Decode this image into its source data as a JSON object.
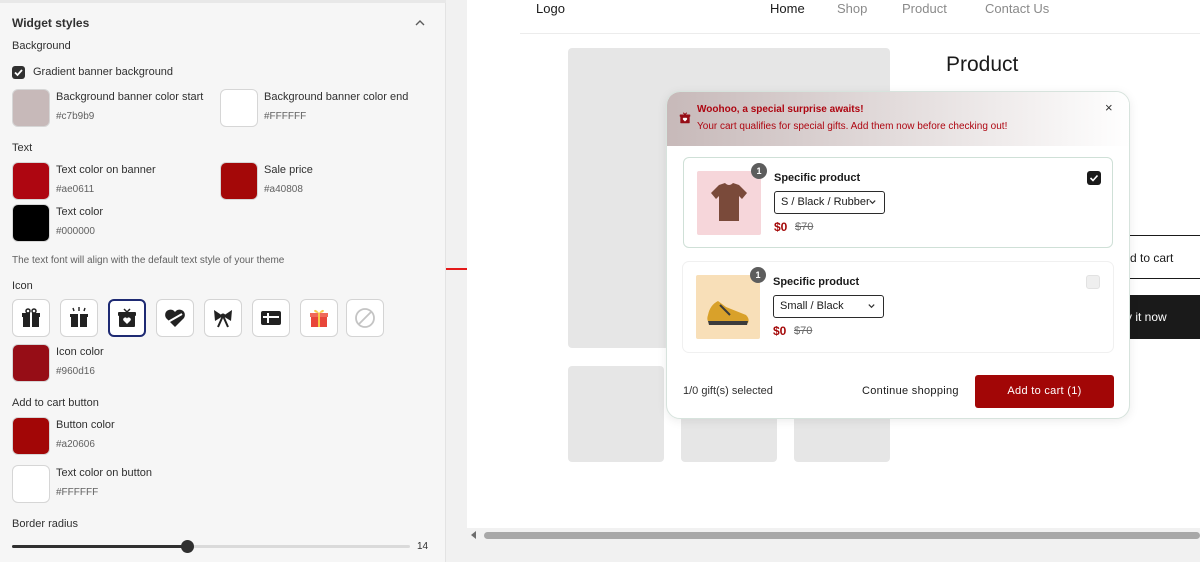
{
  "settings": {
    "title": "Widget styles",
    "background_section": "Background",
    "gradient_label": "Gradient banner background",
    "gradient_checked": true,
    "bg_start_label": "Background banner color start",
    "bg_start_hex": "#c7b9b9",
    "bg_end_label": "Background banner color end",
    "bg_end_hex": "#FFFFFF",
    "text_section": "Text",
    "banner_text_label": "Text color on banner",
    "banner_text_hex": "#ae0611",
    "sale_price_label": "Sale price",
    "sale_price_hex": "#a40808",
    "text_color_label": "Text color",
    "text_color_hex": "#000000",
    "font_note": "The text font will align with the default text style of your theme",
    "icon_section": "Icon",
    "icon_options": [
      "gift-box-icon",
      "gift-sparkle-icon",
      "gift-heart-box-icon",
      "heart-ribbon-icon",
      "bow-icon",
      "gift-card-icon",
      "present-emoji-icon",
      "none-icon"
    ],
    "selected_icon": "gift-heart-box-icon",
    "icon_color_label": "Icon color",
    "icon_color_hex": "#960d16",
    "atc_section": "Add to cart button",
    "button_color_label": "Button color",
    "button_color_hex": "#a20606",
    "button_text_label": "Text color on button",
    "button_text_hex": "#FFFFFF",
    "radius_section": "Border radius",
    "radius_value": "14",
    "radius_fraction": 0.44
  },
  "preview": {
    "logo": "Logo",
    "nav": [
      "Home",
      "Shop",
      "Product",
      "Contact Us"
    ],
    "active_nav": "Home",
    "product_title": "Product",
    "add_to_cart_partial": "d to cart",
    "buy_now_partial": "y it now"
  },
  "popup": {
    "banner_title": "Woohoo, a special surprise awaits!",
    "banner_sub": "Your cart qualifies for special gifts. Add them now before checking out!",
    "close": "×",
    "items": [
      {
        "qty": "1",
        "name": "Specific product",
        "variant": "S / Black / Rubber",
        "sale_price": "$0",
        "compare_price": "$70",
        "checked": true
      },
      {
        "qty": "1",
        "name": "Specific product",
        "variant": "Small / Black",
        "sale_price": "$0",
        "compare_price": "$70",
        "checked": false
      }
    ],
    "selected_count": "1/0 gift(s) selected",
    "continue_label": "Continue shopping",
    "add_label": "Add to cart (1)"
  },
  "colors": {
    "banner_start": "#c7b9b9",
    "banner_text": "#ae0611",
    "sale": "#a40808",
    "icon": "#960d16",
    "button": "#a20606",
    "arrow": "#e41a1a"
  }
}
